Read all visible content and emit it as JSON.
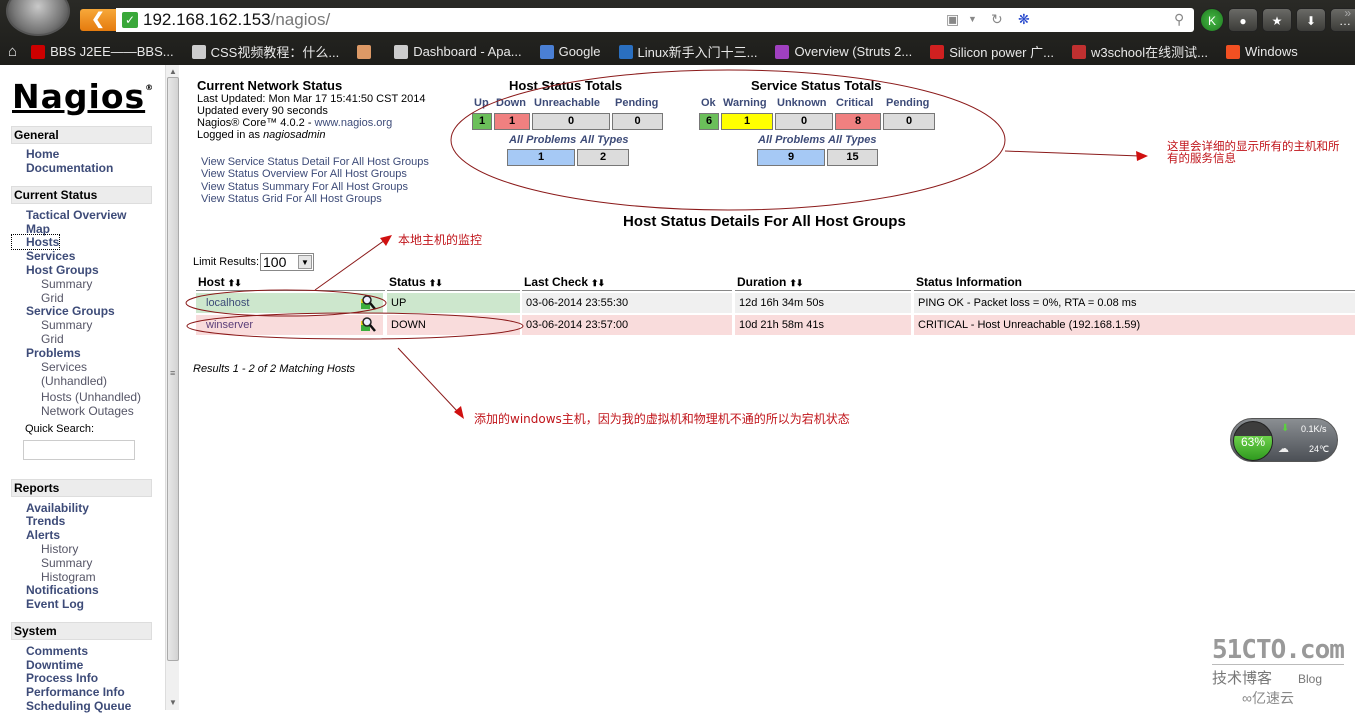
{
  "browser": {
    "back_icon": "chevron-left-icon",
    "url_host": "192.168.162.153",
    "url_path": "/nagios/",
    "toolbar_icons": [
      "popup-blocker-icon",
      "reload-icon",
      "baidu-search-icon",
      "search-icon"
    ],
    "buttons": [
      {
        "name": "kaspersky-button",
        "glyph": "K"
      },
      {
        "name": "lock-button",
        "glyph": "🔒"
      },
      {
        "name": "favorites-button",
        "glyph": "★"
      },
      {
        "name": "download-button",
        "glyph": "⬇"
      },
      {
        "name": "menu-button",
        "glyph": "…"
      }
    ],
    "bookmarks": [
      {
        "label": "BBS J2EE——BBS...",
        "icon": "pudn-icon",
        "color": "#c00"
      },
      {
        "label": "CSS视频教程：什么...",
        "icon": "page-icon",
        "color": "#ccc"
      },
      {
        "label": "",
        "icon": "shield-icon",
        "color": "#d96"
      },
      {
        "label": "Dashboard - Apa...",
        "icon": "page-icon",
        "color": "#ccc"
      },
      {
        "label": "Google",
        "icon": "google-icon",
        "color": "#4a7fd4"
      },
      {
        "label": "Linux新手入门十三...",
        "icon": "w-icon",
        "color": "#2a6fc0"
      },
      {
        "label": "Overview (Struts 2...",
        "icon": "feather-icon",
        "color": "#a040c0"
      },
      {
        "label": "Silicon power 广...",
        "icon": "sp-icon",
        "color": "#d02020"
      },
      {
        "label": "w3school在线测试...",
        "icon": "w3-icon",
        "color": "#c03030"
      },
      {
        "label": "Windows",
        "icon": "windows-icon",
        "color": "#f25022"
      }
    ]
  },
  "sidebar": {
    "logo": "Nagios",
    "sections": {
      "general": "General",
      "current_status": "Current Status",
      "reports": "Reports",
      "system": "System"
    },
    "general_items": [
      "Home",
      "Documentation"
    ],
    "current_status_items": {
      "tactical_overview": "Tactical Overview",
      "map": "Map",
      "hosts": "Hosts",
      "services": "Services",
      "host_groups": "Host Groups",
      "hg_summary": "Summary",
      "hg_grid": "Grid",
      "service_groups": "Service Groups",
      "sg_summary": "Summary",
      "sg_grid": "Grid",
      "problems": "Problems",
      "p_services": "Services",
      "p_services_unhandled": "(Unhandled)",
      "p_hosts": "Hosts",
      "p_hosts_unhandled": "(Unhandled)",
      "network_outages": "Network Outages"
    },
    "quick_search_label": "Quick Search:",
    "quick_search_value": "",
    "reports_items": {
      "availability": "Availability",
      "trends": "Trends",
      "alerts": "Alerts",
      "history": "History",
      "summary": "Summary",
      "histogram": "Histogram",
      "notifications": "Notifications",
      "event_log": "Event Log"
    },
    "system_items": [
      "Comments",
      "Downtime",
      "Process Info",
      "Performance Info",
      "Scheduling Queue"
    ]
  },
  "status_info": {
    "title": "Current Network Status",
    "last_updated": "Last Updated: Mon Mar 17 15:41:50 CST 2014",
    "update_interval": "Updated every 90 seconds",
    "version_prefix": "Nagios® Core™ 4.0.2 - ",
    "version_link": "www.nagios.org",
    "logged_in_prefix": "Logged in as ",
    "logged_in_user": "nagiosadmin",
    "links": [
      "View Service Status Detail For All Host Groups",
      "View Status Overview For All Host Groups",
      "View Status Summary For All Host Groups",
      "View Status Grid For All Host Groups"
    ]
  },
  "host_totals": {
    "title": "Host Status Totals",
    "labels": {
      "up": "Up",
      "down": "Down",
      "unreachable": "Unreachable",
      "pending": "Pending",
      "all_problems": "All Problems",
      "all_types": "All Types"
    },
    "values": {
      "up": "1",
      "down": "1",
      "unreachable": "0",
      "pending": "0",
      "all_problems": "1",
      "all_types": "2"
    }
  },
  "service_totals": {
    "title": "Service Status Totals",
    "labels": {
      "ok": "Ok",
      "warning": "Warning",
      "unknown": "Unknown",
      "critical": "Critical",
      "pending": "Pending",
      "all_problems": "All Problems",
      "all_types": "All Types"
    },
    "values": {
      "ok": "6",
      "warning": "1",
      "unknown": "0",
      "critical": "8",
      "pending": "0",
      "all_problems": "9",
      "all_types": "15"
    }
  },
  "colors": {
    "ok": "#6bbf5a",
    "down": "#f08080",
    "warning": "#ffff00",
    "neutral": "#dcdcdc",
    "problems": "#a6c9f5",
    "row_ok": "#cde7cd",
    "row_critical": "#f9dcdc",
    "annotation": "#c0141a"
  },
  "host_details": {
    "title": "Host Status Details For All Host Groups",
    "limit_label": "Limit Results:",
    "limit_value": "100",
    "columns": [
      "Host",
      "Status",
      "Last Check",
      "Duration",
      "Status Information"
    ],
    "sort_glyph": "⬆⬇",
    "rows": [
      {
        "host": "localhost",
        "status": "UP",
        "last_check": "03-06-2014 23:55:30",
        "duration": "12d 16h 34m 50s",
        "info": "PING OK - Packet loss = 0%, RTA = 0.08 ms"
      },
      {
        "host": "winserver",
        "status": "DOWN",
        "last_check": "03-06-2014 23:57:00",
        "duration": "10d 21h 58m 41s",
        "info": "CRITICAL - Host Unreachable (192.168.1.59)"
      }
    ],
    "results_text": "Results 1 - 2 of 2 Matching Hosts"
  },
  "annotations": {
    "totals_note": "这里会详细的显示所有的主机和所有的服务信息",
    "totals_note_line1": "这里会详细的显示所有的主机和所",
    "totals_note_line2": "有的服务信息",
    "localhost_note": "本地主机的监控",
    "winserver_note": "添加的windows主机，因为我的虚拟机和物理机不通的所以为宕机状态"
  },
  "net_widget": {
    "memory_percent": "63%",
    "speed": "0.1K/s",
    "temperature": "24℃"
  },
  "watermark": {
    "site": "51CTO.com",
    "tagline": "技术博客",
    "blog": "Blog",
    "brand": "亿速云"
  }
}
